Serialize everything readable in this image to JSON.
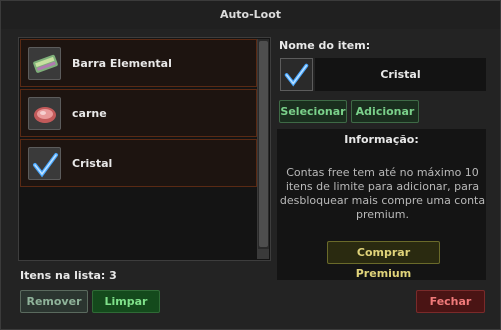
{
  "window": {
    "title": "Auto-Loot"
  },
  "list": {
    "items": [
      {
        "label": "Barra Elemental",
        "icon": "elemental-bar-icon"
      },
      {
        "label": "carne",
        "icon": "meat-icon"
      },
      {
        "label": "Cristal",
        "icon": "crystal-icon"
      }
    ],
    "count_label": "Itens na lista: 3"
  },
  "buttons": {
    "remover": "Remover",
    "limpar": "Limpar",
    "fechar": "Fechar",
    "selecionar": "Selecionar",
    "adicionar": "Adicionar",
    "comprar_premium": "Comprar Premium"
  },
  "item_panel": {
    "label": "Nome do item:",
    "selected_name": "Cristal",
    "selected_icon": "crystal-icon"
  },
  "info": {
    "title": "Informação:",
    "text": "Contas free tem até no máximo 10 itens de limite para adicionar, para desbloquear mais compre uma conta premium."
  },
  "colors": {
    "item_border": "#5a2a14",
    "accent_green": "#7ad08a",
    "close_red": "#f07a7a",
    "premium_gold": "#e0d37a"
  }
}
